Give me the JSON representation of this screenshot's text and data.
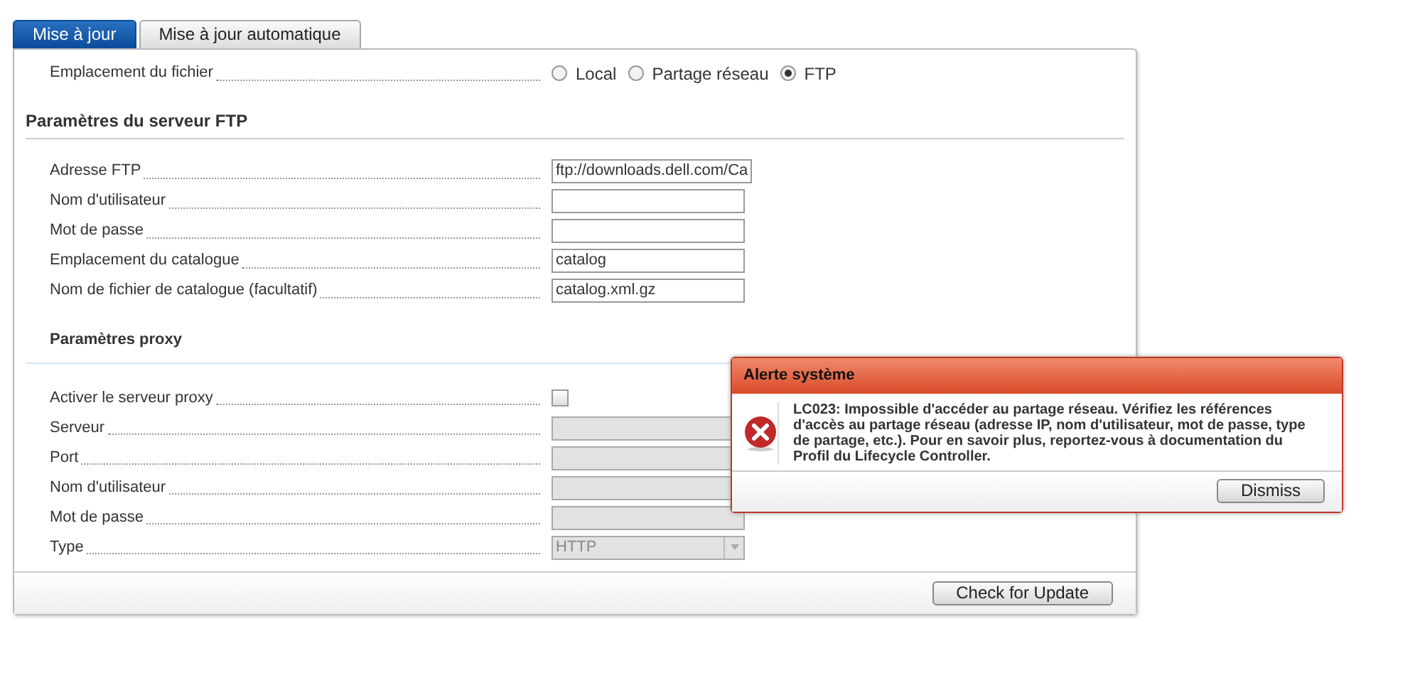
{
  "tabs": [
    {
      "label": "Mise à jour",
      "selected": true
    },
    {
      "label": "Mise à jour automatique",
      "selected": false
    }
  ],
  "file_location": {
    "label": "Emplacement du fichier",
    "options": [
      {
        "label": "Local",
        "selected": false
      },
      {
        "label": "Partage réseau",
        "selected": false
      },
      {
        "label": "FTP",
        "selected": true
      }
    ]
  },
  "ftp_section": {
    "title": "Paramètres du serveur FTP",
    "fields": [
      {
        "label": "Adresse FTP",
        "value": "ftp://downloads.dell.com/Ca"
      },
      {
        "label": "Nom d'utilisateur"
      },
      {
        "label": "Mot de passe"
      },
      {
        "label": "Emplacement du catalogue",
        "value": "catalog"
      },
      {
        "label": "Nom de fichier de catalogue (facultatif)",
        "value": "catalog.xml.gz"
      }
    ]
  },
  "proxy_section": {
    "title": "Paramètres proxy",
    "fields": [
      {
        "kind": "checkbox",
        "label": "Activer le serveur proxy",
        "checked": false
      },
      {
        "kind": "text",
        "label": "Serveur",
        "disabled": true
      },
      {
        "kind": "text",
        "label": "Port",
        "disabled": true
      },
      {
        "kind": "text",
        "label": "Nom d'utilisateur",
        "disabled": true
      },
      {
        "kind": "text",
        "label": "Mot de passe",
        "disabled": true
      },
      {
        "kind": "select",
        "label": "Type",
        "value": "HTTP",
        "disabled": true
      }
    ]
  },
  "footer_button": "Check for Update",
  "alert": {
    "title": "Alerte système",
    "message": "LC023: Impossible d'accéder au partage réseau. Vérifiez les références d'accès au partage réseau (adresse IP, nom d'utilisateur, mot de passe, type de partage, etc.).  Pour en savoir plus, reportez-vous à documentation du Profil du Lifecycle Controller.",
    "button": "Dismiss"
  }
}
